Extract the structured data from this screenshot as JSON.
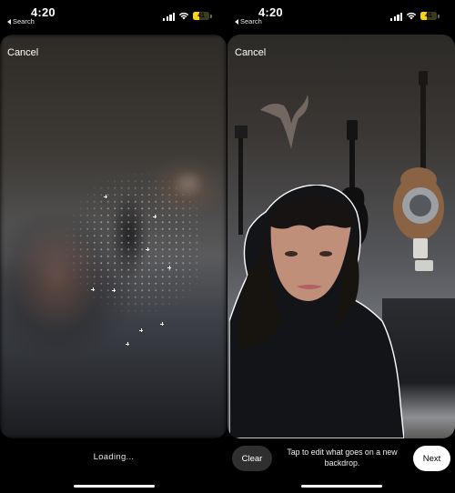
{
  "status_bar": {
    "time": "4:20",
    "back_label": "Search",
    "battery_level": "41",
    "battery_fraction": 0.41,
    "icons": [
      "signal-icon",
      "wifi-icon",
      "battery-icon"
    ]
  },
  "left_screen": {
    "cancel_label": "Cancel",
    "status_text": "Loading...",
    "photo_state": "blurred-processing"
  },
  "right_screen": {
    "cancel_label": "Cancel",
    "clear_label": "Clear",
    "hint_text": "Tap to edit what goes on a new backdrop.",
    "next_label": "Next",
    "photo_state": "subject-cutout"
  },
  "colors": {
    "background": "#000000",
    "battery_fill": "#f5d516",
    "clear_button": "#2f2f2f",
    "next_button": "#ffffff",
    "cutout_outline": "#ffffff"
  }
}
